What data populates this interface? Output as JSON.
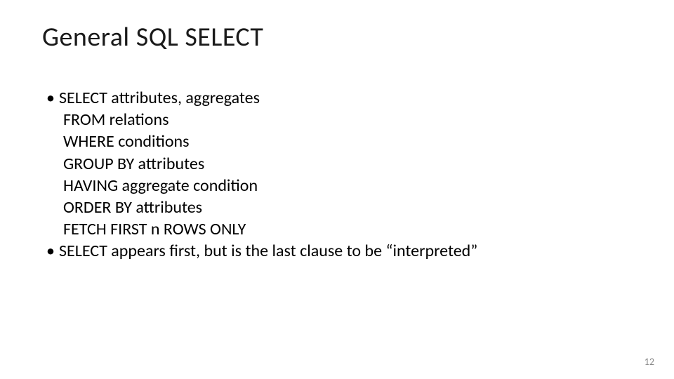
{
  "slide": {
    "title": "General SQL SELECT",
    "bullets": [
      {
        "head": "SELECT attributes, aggregates",
        "continuations": [
          "FROM relations",
          "WHERE conditions",
          "GROUP BY attributes",
          "HAVING aggregate condition",
          "ORDER BY attributes",
          "FETCH FIRST n ROWS ONLY"
        ]
      },
      {
        "head": "SELECT appears first, but is the last clause to be “interpreted”",
        "continuations": []
      }
    ],
    "page_number": "12"
  }
}
